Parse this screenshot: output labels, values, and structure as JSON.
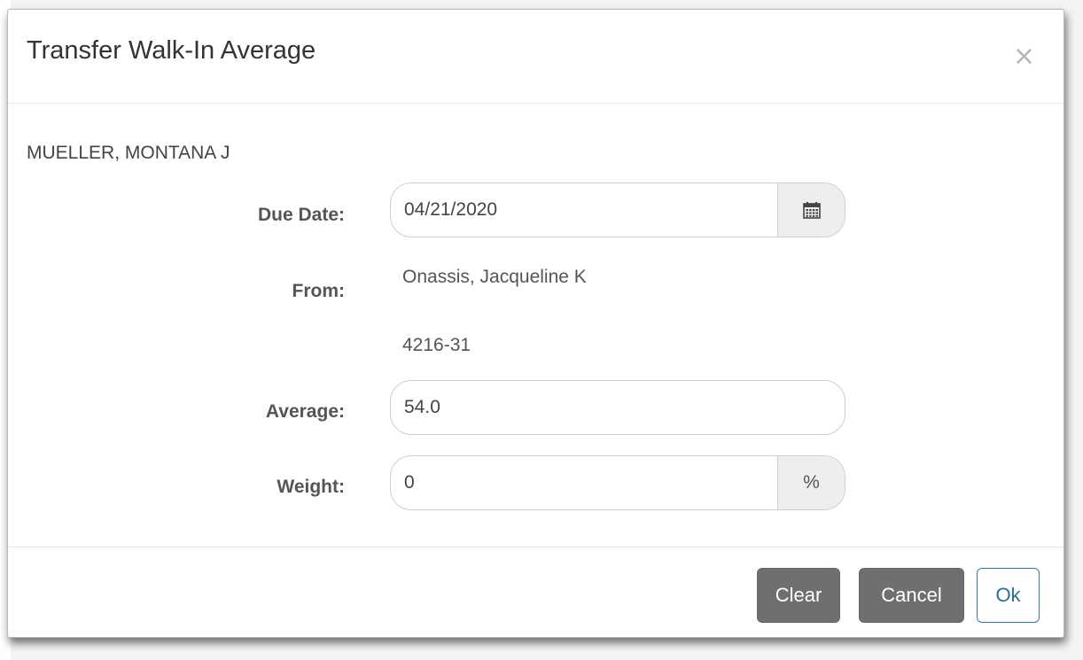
{
  "dialog": {
    "title": "Transfer Walk-In Average",
    "close_glyph": "×",
    "student_name": "MUELLER, MONTANA J"
  },
  "fields": {
    "due_date": {
      "label": "Due Date:",
      "value": "04/21/2020",
      "addon_icon": "calendar-icon"
    },
    "from": {
      "label": "From:",
      "teacher": "Onassis, Jacqueline K",
      "section": "4216-31"
    },
    "average": {
      "label": "Average:",
      "value": "54.0"
    },
    "weight": {
      "label": "Weight:",
      "value": "0",
      "addon_text": "%"
    }
  },
  "footer": {
    "clear_label": "Clear",
    "cancel_label": "Cancel",
    "ok_label": "Ok"
  }
}
